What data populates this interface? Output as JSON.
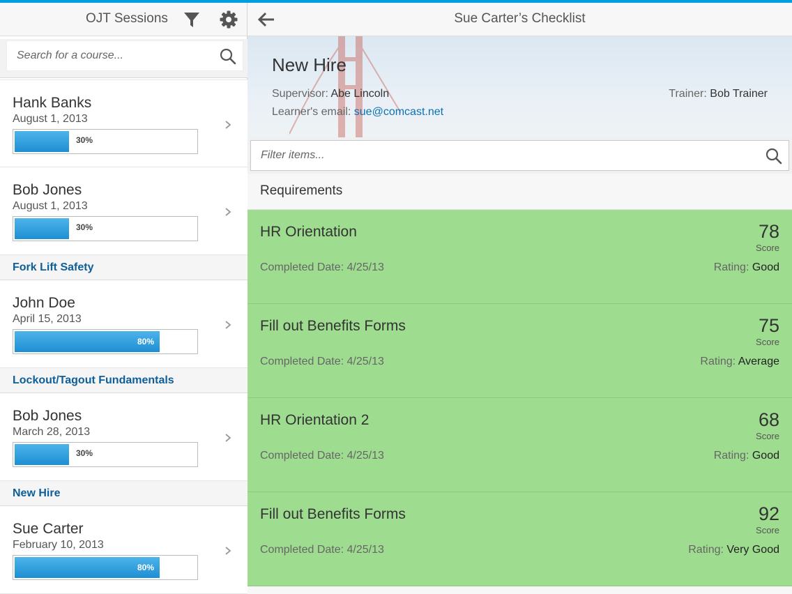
{
  "master": {
    "title": "OJT Sessions",
    "search_placeholder": "Search for a course...",
    "items": [
      {
        "name": "Hank Banks",
        "date": "August 1, 2013",
        "progress": "30%",
        "progress_fraction": 0.3
      },
      {
        "name": "Bob Jones",
        "date": "August 1, 2013",
        "progress": "30%",
        "progress_fraction": 0.3
      }
    ],
    "groups": [
      {
        "title": "Fork Lift Safety",
        "items": [
          {
            "name": "John Doe",
            "date": "April 15, 2013",
            "progress": "80%",
            "progress_fraction": 0.8
          }
        ]
      },
      {
        "title": "Lockout/Tagout Fundamentals",
        "items": [
          {
            "name": "Bob Jones",
            "date": "March 28, 2013",
            "progress": "30%",
            "progress_fraction": 0.3
          }
        ]
      },
      {
        "title": "New Hire",
        "items": [
          {
            "name": "Sue Carter",
            "date": "February 10, 2013",
            "progress": "80%",
            "progress_fraction": 0.8
          }
        ]
      }
    ]
  },
  "detail": {
    "title": "Sue Carter’s Checklist",
    "object_title": "New Hire",
    "supervisor_label": "Supervisor:",
    "supervisor": "Abe Lincoln",
    "email_label": "Learner's email:",
    "email": "sue@comcast.net",
    "trainer_label": "Trainer:",
    "trainer": "Bob Trainer",
    "filter_placeholder": "Filter items...",
    "requirements_header": "Requirements",
    "completed_label": "Completed Date:",
    "score_label": "Score",
    "rating_label": "Rating:",
    "requirements": [
      {
        "name": "HR Orientation",
        "date": "4/25/13",
        "score": "78",
        "rating": "Good"
      },
      {
        "name": "Fill out Benefits Forms",
        "date": "4/25/13",
        "score": "75",
        "rating": "Average"
      },
      {
        "name": "HR Orientation 2",
        "date": "4/25/13",
        "score": "68",
        "rating": "Good"
      },
      {
        "name": "Fill out Benefits Forms",
        "date": "4/25/13",
        "score": "92",
        "rating": "Very Good"
      }
    ]
  },
  "icons": {
    "filter": "filter-icon",
    "settings": "gear-icon",
    "back": "arrow-left-icon",
    "search": "search-icon",
    "chevron": "chevron-right-icon"
  },
  "colors": {
    "accent": "#009de0",
    "progress": "#1e8fd2",
    "group_header_text": "#0e5e99",
    "requirement_bg": "#9edc90",
    "link": "#0a72b5"
  }
}
